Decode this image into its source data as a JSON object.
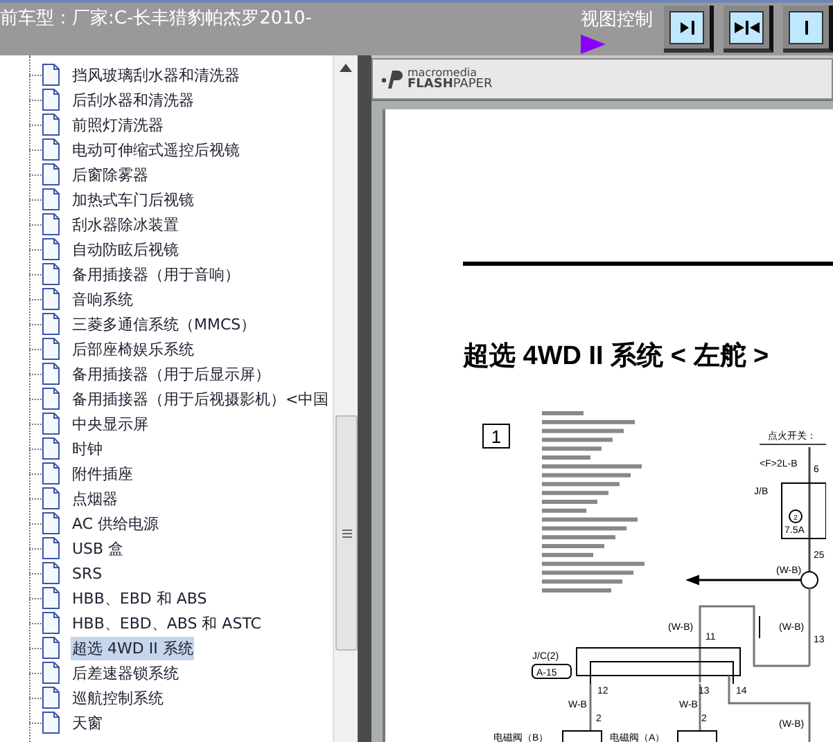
{
  "header": {
    "title": "前车型：厂家:C-长丰猎豹帕杰罗2010-",
    "view_control_label": "视图控制"
  },
  "tree": {
    "items": [
      {
        "label": "挡风玻璃刮水器和清洗器",
        "selected": false
      },
      {
        "label": "后刮水器和清洗器",
        "selected": false
      },
      {
        "label": "前照灯清洗器",
        "selected": false
      },
      {
        "label": "电动可伸缩式遥控后视镜",
        "selected": false
      },
      {
        "label": "后窗除雾器",
        "selected": false
      },
      {
        "label": "加热式车门后视镜",
        "selected": false
      },
      {
        "label": "刮水器除冰装置",
        "selected": false
      },
      {
        "label": "自动防眩后视镜",
        "selected": false
      },
      {
        "label": "备用插接器（用于音响）",
        "selected": false
      },
      {
        "label": "音响系统",
        "selected": false
      },
      {
        "label": "三菱多通信系统（MMCS）",
        "selected": false
      },
      {
        "label": "后部座椅娱乐系统",
        "selected": false
      },
      {
        "label": "备用插接器（用于后显示屏）",
        "selected": false
      },
      {
        "label": "备用插接器（用于后视摄影机）<中国",
        "selected": false
      },
      {
        "label": "中央显示屏",
        "selected": false
      },
      {
        "label": "时钟",
        "selected": false
      },
      {
        "label": "附件插座",
        "selected": false
      },
      {
        "label": "点烟器",
        "selected": false
      },
      {
        "label": "AC 供给电源",
        "selected": false
      },
      {
        "label": "USB 盒",
        "selected": false
      },
      {
        "label": "SRS",
        "selected": false
      },
      {
        "label": "HBB、EBD 和 ABS",
        "selected": false
      },
      {
        "label": "HBB、EBD、ABS 和 ASTC",
        "selected": false
      },
      {
        "label": "超选 4WD II 系统",
        "selected": true
      },
      {
        "label": "后差速器锁系统",
        "selected": false
      },
      {
        "label": "巡航控制系统",
        "selected": false
      },
      {
        "label": "天窗",
        "selected": false
      }
    ]
  },
  "viewer": {
    "logo_top": "macromedia",
    "logo_bold": "FLASH",
    "logo_light": "PAPER",
    "page": {
      "heading": "超选 4WD II 系统 < 左舵 >",
      "section_number": "1",
      "diagram_labels": [
        "点火开关：",
        "<F>2L-B",
        "6",
        "J/B",
        "2",
        "7.5A",
        "25",
        "(W-B)",
        "(W-B)",
        "11",
        "(W-B)",
        "13",
        "J/C(2)",
        "A-15",
        "12",
        "13",
        "14",
        "W-B",
        "W-B",
        "(W-B)",
        "2",
        "2",
        "电磁阀（B）",
        "电磁阀（A）"
      ]
    }
  }
}
